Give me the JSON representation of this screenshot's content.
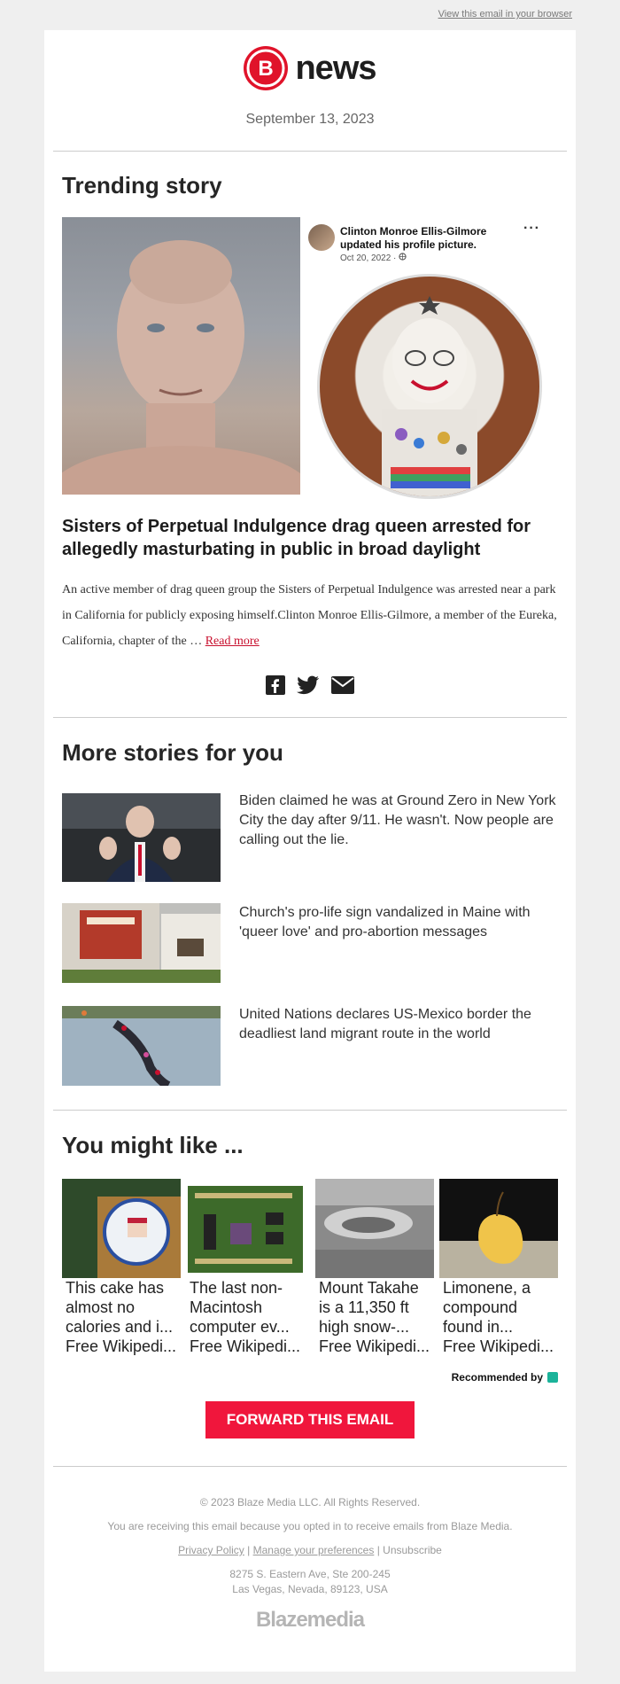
{
  "header": {
    "view_in_browser": "View this email in your browser",
    "brand_letter": "B",
    "brand_name": "news",
    "date": "September 13, 2023"
  },
  "trending": {
    "section_title": "Trending story",
    "fb_post": {
      "name": "Clinton Monroe Ellis-Gilmore",
      "action": "updated his profile picture.",
      "date": "Oct 20, 2022 ·",
      "more": "···"
    },
    "headline": "Sisters of Perpetual Indulgence drag queen arrested for allegedly masturbating in public in broad daylight",
    "body": "An active member of drag queen group the Sisters of Perpetual Indulgence was arrested near a park in California for publicly exposing himself.Clinton Monroe Ellis-Gilmore, a member of the Eureka, California, chapter of the … ",
    "read_more": "Read more",
    "share_icons": [
      "facebook-icon",
      "twitter-icon",
      "email-icon"
    ]
  },
  "more_stories": {
    "section_title": "More stories for you",
    "items": [
      {
        "title": "Biden claimed he was at Ground Zero in New York City the day after 9/11. He wasn't. Now people are calling out the lie."
      },
      {
        "title": "Church's pro-life sign vandalized in Maine with 'queer love' and pro-abortion messages"
      },
      {
        "title": "United Nations declares US-Mexico border the deadliest land migrant route in the world"
      }
    ]
  },
  "you_might_like": {
    "section_title": "You might like ...",
    "items": [
      {
        "title_lines": [
          "This cake has",
          "almost no",
          "calories and i..."
        ],
        "source": "Free Wikipedi..."
      },
      {
        "title_lines": [
          "The last non-",
          "Macintosh",
          "computer ev..."
        ],
        "source": "Free Wikipedi..."
      },
      {
        "title_lines": [
          "Mount Takahe",
          "is a 11,350 ft",
          "high snow-..."
        ],
        "source": "Free Wikipedi..."
      },
      {
        "title_lines": [
          "Limonene, a",
          "compound",
          "found in..."
        ],
        "source": "Free Wikipedi..."
      }
    ],
    "recommended_by": "Recommended by"
  },
  "forward_button": "FORWARD THIS EMAIL",
  "footer": {
    "copyright": "© 2023 Blaze Media LLC. All Rights Reserved.",
    "optin": "You are receiving this email because you opted in to receive emails from Blaze Media.",
    "privacy": "Privacy Policy",
    "preferences": "Manage your preferences",
    "unsubscribe": "Unsubscribe",
    "address1": "8275 S. Eastern Ave, Ste 200-245",
    "address2": "Las Vegas, Nevada, 89123, USA",
    "logo": "Blazemedia"
  },
  "colors": {
    "brand_red": "#e0132a",
    "button_red": "#f0163c",
    "link_red": "#c8102e"
  }
}
